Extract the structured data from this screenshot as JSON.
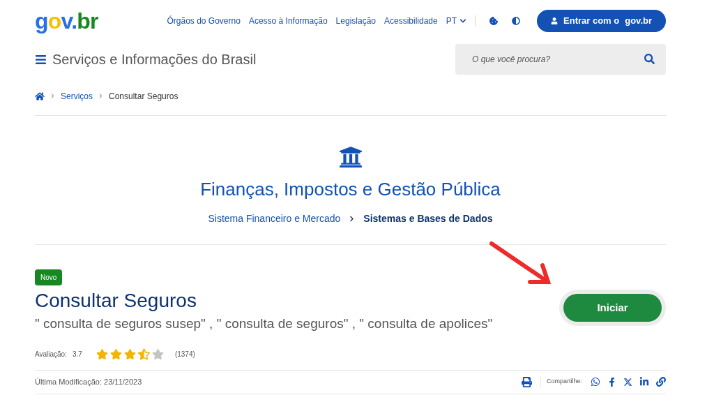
{
  "header": {
    "logo": "gov.br",
    "links": [
      "Órgãos do Governo",
      "Acesso à Informação",
      "Legislação",
      "Acessibilidade"
    ],
    "language": "PT",
    "login_button": {
      "prefix": "Entrar com o",
      "brand": "gov.br"
    }
  },
  "site_title": "Serviços e Informações do Brasil",
  "search": {
    "placeholder": "O que você procura?"
  },
  "breadcrumb": [
    "Serviços",
    "Consultar Seguros"
  ],
  "category": {
    "title": "Finanças, Impostos e Gestão Pública",
    "path": [
      "Sistema Financeiro e Mercado",
      "Sistemas e Bases de Dados"
    ]
  },
  "service": {
    "badge": "Novo",
    "title": "Consultar Seguros",
    "keywords": "\" consulta de seguros susep\" , \" consulta de seguros\" , \" consulta de apolices\"",
    "action": "Iniciar",
    "annotation": {
      "kind": "arrow"
    }
  },
  "rating": {
    "label": "Avaliação:",
    "score": "3.7",
    "stars": 3.5,
    "count": "(1374)"
  },
  "footer": {
    "modified": "Última Modificação: 23/11/2023",
    "share_label": "Compartilhe:"
  }
}
